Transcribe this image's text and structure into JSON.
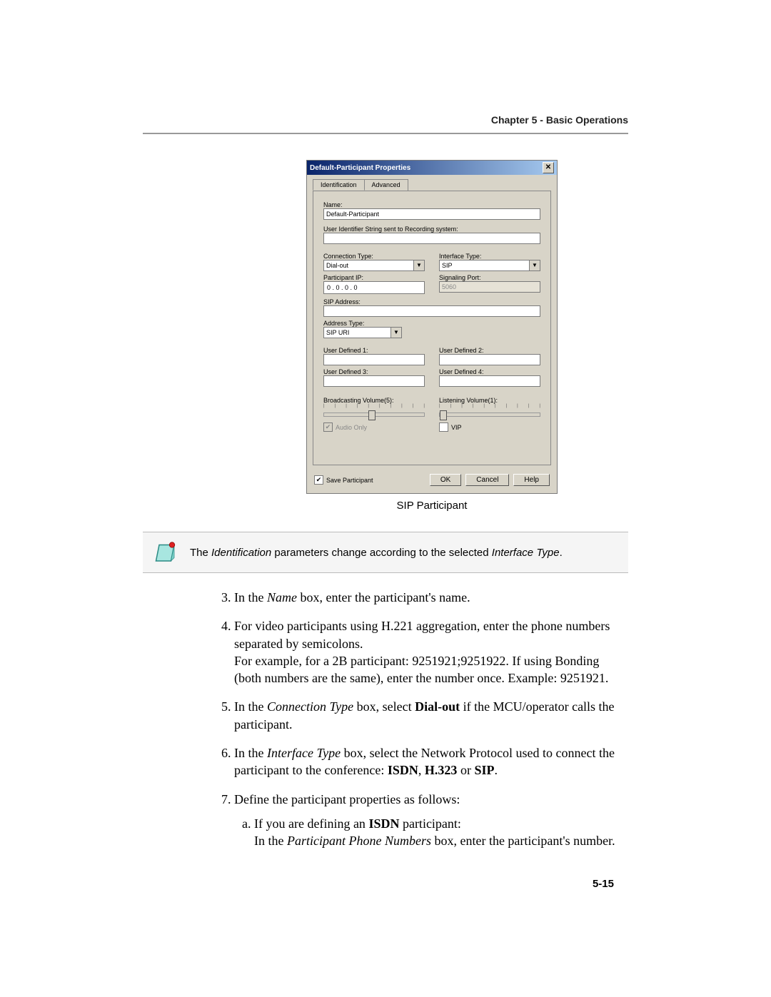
{
  "header": {
    "chapter_label": "Chapter 5 - Basic Operations"
  },
  "dialog": {
    "title": "Default-Participant Properties",
    "tabs": {
      "identification": "Identification",
      "advanced": "Advanced"
    },
    "name_label": "Name:",
    "name_value": "Default-Participant",
    "uid_label": "User Identifier String sent to Recording system:",
    "uid_value": "",
    "conn_type_label": "Connection Type:",
    "conn_type_value": "Dial-out",
    "iface_type_label": "Interface Type:",
    "iface_type_value": "SIP",
    "participant_ip_label": "Participant IP:",
    "participant_ip_value": "0  .  0  .  0  .  0",
    "signaling_port_label": "Signaling Port:",
    "signaling_port_value": "5060",
    "sip_addr_label": "SIP Address:",
    "sip_addr_value": "",
    "addr_type_label": "Address Type:",
    "addr_type_value": "SIP URI",
    "ud1_label": "User Defined 1:",
    "ud2_label": "User Defined 2:",
    "ud3_label": "User Defined 3:",
    "ud4_label": "User Defined 4:",
    "broadcast_label": "Broadcasting Volume(5):",
    "listen_label": "Listening Volume(1):",
    "audio_only_label": "Audio Only",
    "vip_label": "VIP",
    "save_participant_label": "Save Participant",
    "ok": "OK",
    "cancel": "Cancel",
    "help": "Help"
  },
  "caption": "SIP Participant",
  "note": {
    "pre": "The ",
    "em1": "Identification",
    "mid": " parameters change according to the selected ",
    "em2": "Interface Type",
    "post": "."
  },
  "steps": {
    "s3_a": "In the ",
    "s3_em": "Name",
    "s3_b": " box, enter the participant's name.",
    "s4_a": "For video participants using H.221 aggregation, enter the phone numbers separated by semicolons.",
    "s4_b": "For example, for a 2B participant: 9251921;9251922. If using Bonding (both numbers are the same), enter the number once. Example: 9251921.",
    "s5_a": "In the ",
    "s5_em": "Connection Type",
    "s5_b": " box, select ",
    "s5_bold": "Dial-out",
    "s5_c": " if the MCU/operator calls the participant.",
    "s6_a": "In the ",
    "s6_em": "Interface Type",
    "s6_b": " box, select the Network Protocol used to connect the participant to the conference: ",
    "s6_bold1": "ISDN",
    "s6_sep1": ", ",
    "s6_bold2": "H.323",
    "s6_sep2": " or ",
    "s6_bold3": "SIP",
    "s6_end": ".",
    "s7": "Define the participant properties as follows:",
    "s7a_a": "If you are defining an ",
    "s7a_bold": "ISDN",
    "s7a_b": " participant:",
    "s7a_c": "In the ",
    "s7a_em": "Participant Phone Numbers",
    "s7a_d": " box, enter the participant's number."
  },
  "page_number": "5-15"
}
